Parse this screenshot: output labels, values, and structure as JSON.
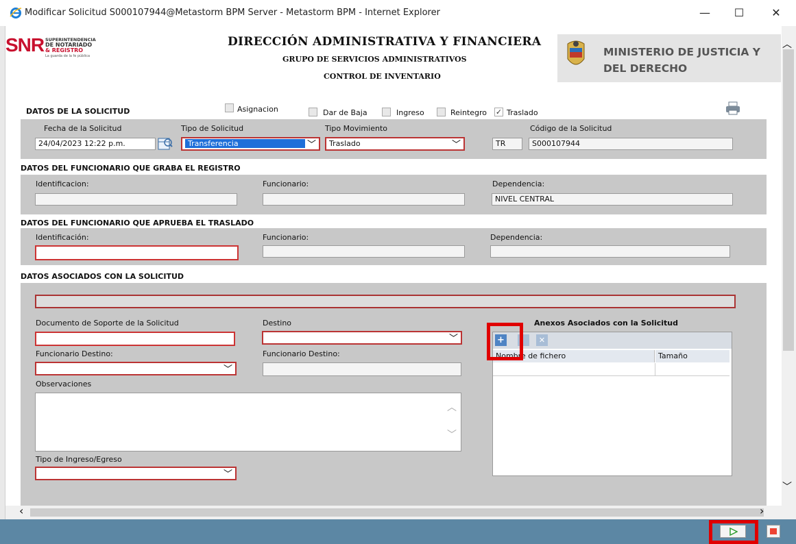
{
  "window": {
    "title": "Modificar Solicitud S000107944@Metastorm BPM Server - Metastorm BPM - Internet Explorer",
    "minimize": "—",
    "maximize": "☐",
    "close": "✕"
  },
  "header": {
    "logo_main": "SNR",
    "logo_line1": "SUPERINTENDENCIA",
    "logo_line2": "DE NOTARIADO",
    "logo_line3": "& REGISTRO",
    "logo_tagline": "La guarda de la fe pública",
    "title1": "DIRECCIÓN ADMINISTRATIVA Y FINANCIERA",
    "title2": "GRUPO DE SERVICIOS ADMINISTRATIVOS",
    "title3": "CONTROL DE INVENTARIO",
    "ministry_line1": "MINISTERIO DE JUSTICIA Y",
    "ministry_line2": "DEL DERECHO"
  },
  "solicitud": {
    "section_title": "DATOS DE LA SOLICITUD",
    "checkboxes": [
      {
        "label": "Asignacion",
        "checked": false
      },
      {
        "label": "Dar de Baja",
        "checked": false
      },
      {
        "label": "Ingreso",
        "checked": false
      },
      {
        "label": "Reintegro",
        "checked": false
      },
      {
        "label": "Traslado",
        "checked": true
      }
    ],
    "fecha_label": "Fecha de la Solicitud",
    "fecha_value": "24/04/2023 12:22 p.m.",
    "tipo_label": "Tipo de Solicitud",
    "tipo_value": "Transferencia",
    "movimiento_label": "Tipo Movimiento",
    "movimiento_value": "Traslado",
    "codigo_label": "Código de la Solicitud",
    "codigo_prefix": "TR",
    "codigo_value": "S000107944"
  },
  "graba": {
    "section_title": "DATOS DEL FUNCIONARIO QUE GRABA EL REGISTRO",
    "id_label": "Identificacion:",
    "id_value": "",
    "func_label": "Funcionario:",
    "func_value": "",
    "dep_label": "Dependencia:",
    "dep_value": "NIVEL CENTRAL"
  },
  "aprueba": {
    "section_title": "DATOS DEL FUNCIONARIO QUE APRUEBA EL TRASLADO",
    "id_label": "Identificación:",
    "func_label": "Funcionario:",
    "dep_label": "Dependencia:"
  },
  "asociados": {
    "section_title": "DATOS ASOCIADOS CON LA SOLICITUD",
    "doc_label": "Documento de Soporte de la Solicitud",
    "destino_label": "Destino",
    "func_destino_label": "Funcionario Destino:",
    "func_destino_label2": "Funcionario Destino:",
    "obs_label": "Observaciones",
    "tipo_ie_label": "Tipo de Ingreso/Egreso"
  },
  "anexos": {
    "title": "Anexos Asociados con la Solicitud",
    "col_name": "Nombre de fichero",
    "col_size": "Tamaño",
    "add_icon": "+",
    "remove_icon": "✕"
  },
  "colors": {
    "highlight": "#e00000",
    "panel": "#c8c8c8",
    "bottombar": "#5c87a4",
    "required_border": "#b33333"
  }
}
